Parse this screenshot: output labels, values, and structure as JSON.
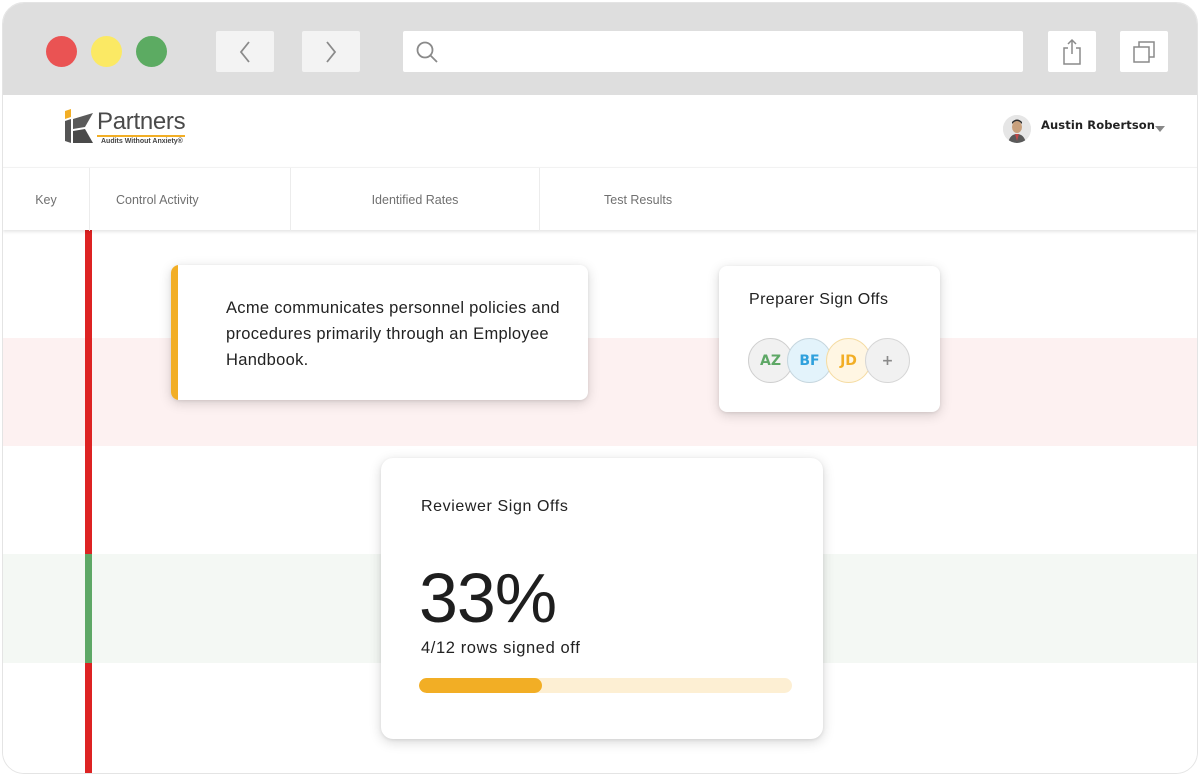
{
  "browser": {
    "url_placeholder": "",
    "url_value": "",
    "icons": {
      "back": "chevron-left-icon",
      "forward": "chevron-right-icon",
      "search": "search-icon",
      "share": "share-icon",
      "tabs": "tabs-icon"
    }
  },
  "header": {
    "logo": {
      "wordmark": "Partners",
      "tagline": "Audits Without Anxiety®",
      "accent": "#f2ae25"
    },
    "user": {
      "name": "Austin Robertson"
    }
  },
  "table": {
    "columns": [
      {
        "label": "Key"
      },
      {
        "label": "Control Activity"
      },
      {
        "label": "Identified Rates"
      },
      {
        "label": "Test Results"
      }
    ],
    "rows": [
      {
        "status": "fail",
        "key_color": "#dd2323",
        "background": "#ffffff"
      },
      {
        "status": "fail",
        "key_color": "#dd2323",
        "background": "#fdf1f1"
      },
      {
        "status": "fail",
        "key_color": "#dd2323",
        "background": "#ffffff"
      },
      {
        "status": "pass",
        "key_color": "#5ea866",
        "background": "#f4f8f4"
      },
      {
        "status": "fail",
        "key_color": "#dd2323",
        "background": "#ffffff"
      }
    ]
  },
  "control_activity_card": {
    "text": "Acme communicates personnel policies and procedures primarily through an Employee Handbook.",
    "accent_color": "#f2ae25"
  },
  "preparer_card": {
    "title": "Preparer Sign Offs",
    "signers": [
      {
        "initials": "AZ",
        "text_color": "#5ea866",
        "bg": "#f1f1f1",
        "border": "#cfcfcf"
      },
      {
        "initials": "BF",
        "text_color": "#2fa0dc",
        "bg": "#e3f3fb",
        "border": "#c6d6de"
      },
      {
        "initials": "JD",
        "text_color": "#f2ae25",
        "bg": "#fff6e3",
        "border": "#f5dca3"
      },
      {
        "initials": "+",
        "text_color": "#8a8a8a",
        "bg": "#f1f1f1",
        "border": "#d6d6d6"
      }
    ]
  },
  "reviewer_card": {
    "title": "Reviewer Sign Offs",
    "percent_label": "33%",
    "subtitle": "4/12 rows signed off",
    "progress": 0.33,
    "signed": 4,
    "total": 12
  }
}
